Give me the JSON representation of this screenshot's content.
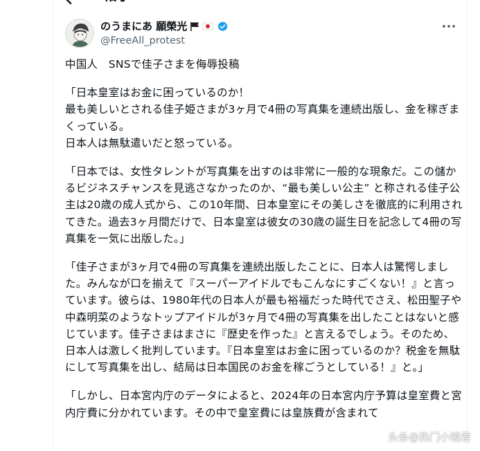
{
  "header": {
    "title": "帖子"
  },
  "post": {
    "author": {
      "display_name": "のうまにあ 願榮光",
      "flags": [
        "black-flag",
        "japan-flag"
      ],
      "verified": true,
      "handle": "@FreeAll_protest"
    },
    "paragraphs": [
      "中国人　SNSで佳子さまを侮辱投稿",
      "「日本皇室はお金に困っているのか！\n最も美しいとされる佳子姫さまが3ヶ月で4冊の写真集を連続出版し、金を稼ぎまくっている。\n日本人は無駄遣いだと怒っている。",
      "「日本では、女性タレントが写真集を出すのは非常に一般的な現象だ。この儲かるビジネスチャンスを見逃さなかったのか、“最も美しい公主” と称される佳子公主は20歳の成人式から、この10年間、日本皇室にその美しさを徹底的に利用されてきた。過去3ヶ月間だけで、日本皇室は彼女の30歳の誕生日を記念して4冊の写真集を一気に出版した。」",
      "「佳子さまが3ヶ月で4冊の写真集を連続出版したことに、日本人は驚愕しました。みんなが口を揃えて『スーパーアイドルでもこんなにすごくない！』と言っています。彼らは、1980年代の日本人が最も裕福だった時代でさえ、松田聖子や中森明菜のようなトップアイドルが3ヶ月で4冊の写真集を出したことはないと感じています。佳子さまはまさに『歴史を作った』と言えるでしょう。そのため、日本人は激しく批判しています。『日本皇室はお金に困っているのか？税金を無駄にして写真集を出し、結局は日本国民のお金を稼ごうとしている！』と。」",
      "「しかし、日本宮内庁のデータによると、2024年の日本宮内庁予算は皇室費と宮内庁費に分かれています。その中で皇室費には皇族費が含まれて"
    ]
  },
  "watermark": "头条@热门小镜君",
  "colors": {
    "text": "#0f1419",
    "secondary": "#536471",
    "verified": "#1d9bf0",
    "border": "#eff3f4"
  },
  "icons": {
    "back": "arrow-left-icon",
    "more": "more-horizontal-icon",
    "verified": "verified-badge-icon"
  }
}
